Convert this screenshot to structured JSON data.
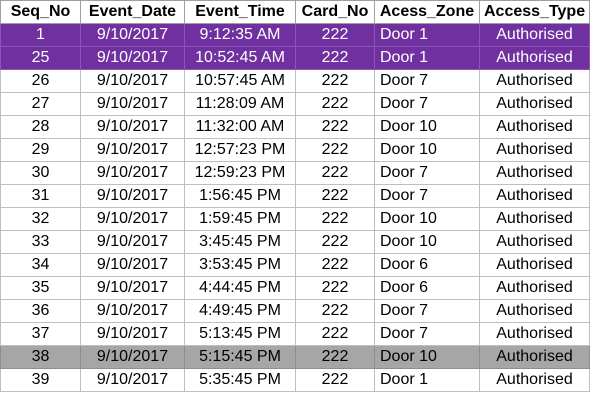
{
  "colors": {
    "highlight_purple": "#7030a0",
    "highlight_grey": "#a6a6a6",
    "grid_line": "#bfbfbf"
  },
  "columns": [
    "Seq_No",
    "Event_Date",
    "Event_Time",
    "Card_No",
    "Acess_Zone",
    "Access_Type"
  ],
  "rows": [
    {
      "seq": "1",
      "date": "9/10/2017",
      "time": "9:12:35 AM",
      "card": "222",
      "zone": "Door 1",
      "type": "Authorised",
      "highlight": "purple"
    },
    {
      "seq": "25",
      "date": "9/10/2017",
      "time": "10:52:45 AM",
      "card": "222",
      "zone": "Door 1",
      "type": "Authorised",
      "highlight": "purple"
    },
    {
      "seq": "26",
      "date": "9/10/2017",
      "time": "10:57:45 AM",
      "card": "222",
      "zone": "Door 7",
      "type": "Authorised",
      "highlight": ""
    },
    {
      "seq": "27",
      "date": "9/10/2017",
      "time": "11:28:09 AM",
      "card": "222",
      "zone": "Door 7",
      "type": "Authorised",
      "highlight": ""
    },
    {
      "seq": "28",
      "date": "9/10/2017",
      "time": "11:32:00 AM",
      "card": "222",
      "zone": "Door 10",
      "type": "Authorised",
      "highlight": ""
    },
    {
      "seq": "29",
      "date": "9/10/2017",
      "time": "12:57:23 PM",
      "card": "222",
      "zone": "Door 10",
      "type": "Authorised",
      "highlight": ""
    },
    {
      "seq": "30",
      "date": "9/10/2017",
      "time": "12:59:23 PM",
      "card": "222",
      "zone": "Door 7",
      "type": "Authorised",
      "highlight": ""
    },
    {
      "seq": "31",
      "date": "9/10/2017",
      "time": "1:56:45 PM",
      "card": "222",
      "zone": "Door 7",
      "type": "Authorised",
      "highlight": ""
    },
    {
      "seq": "32",
      "date": "9/10/2017",
      "time": "1:59:45 PM",
      "card": "222",
      "zone": "Door 10",
      "type": "Authorised",
      "highlight": ""
    },
    {
      "seq": "33",
      "date": "9/10/2017",
      "time": "3:45:45 PM",
      "card": "222",
      "zone": "Door 10",
      "type": "Authorised",
      "highlight": ""
    },
    {
      "seq": "34",
      "date": "9/10/2017",
      "time": "3:53:45 PM",
      "card": "222",
      "zone": "Door 6",
      "type": "Authorised",
      "highlight": ""
    },
    {
      "seq": "35",
      "date": "9/10/2017",
      "time": "4:44:45 PM",
      "card": "222",
      "zone": "Door 6",
      "type": "Authorised",
      "highlight": ""
    },
    {
      "seq": "36",
      "date": "9/10/2017",
      "time": "4:49:45 PM",
      "card": "222",
      "zone": "Door 7",
      "type": "Authorised",
      "highlight": ""
    },
    {
      "seq": "37",
      "date": "9/10/2017",
      "time": "5:13:45 PM",
      "card": "222",
      "zone": "Door 7",
      "type": "Authorised",
      "highlight": ""
    },
    {
      "seq": "38",
      "date": "9/10/2017",
      "time": "5:15:45 PM",
      "card": "222",
      "zone": "Door 10",
      "type": "Authorised",
      "highlight": "grey"
    },
    {
      "seq": "39",
      "date": "9/10/2017",
      "time": "5:35:45 PM",
      "card": "222",
      "zone": "Door 1",
      "type": "Authorised",
      "highlight": ""
    }
  ]
}
